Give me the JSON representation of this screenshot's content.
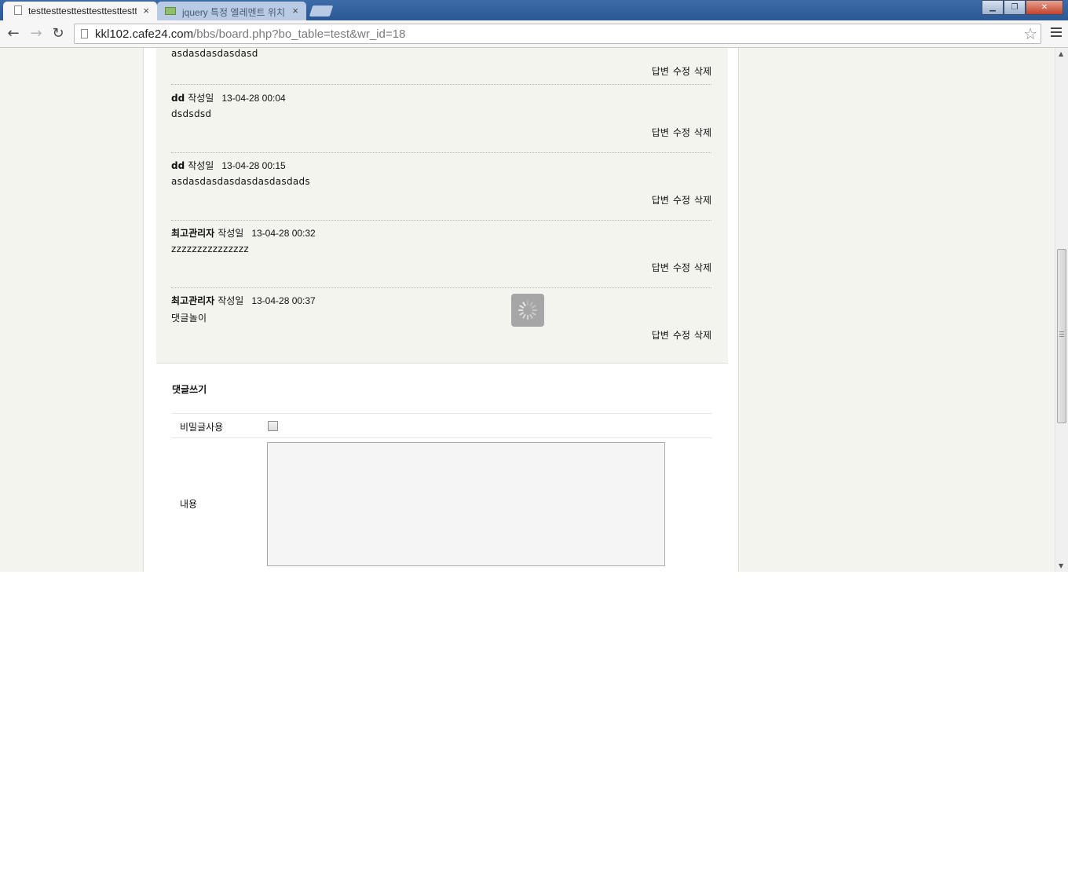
{
  "browser": {
    "tabs": [
      {
        "title": "testtesttesttesttesttesttesttest",
        "active": true,
        "close": "×"
      },
      {
        "title": "jquery 특정 엘레멘트 위치",
        "active": false,
        "close": "×"
      }
    ],
    "window_buttons": {
      "minimize": "▁",
      "maximize": "❐",
      "close": "✕"
    },
    "nav": {
      "back": "←",
      "forward": "→",
      "reload": "↻"
    },
    "url_host": "kkl102.cafe24.com",
    "url_path": "/bbs/board.php?bo_table=test&wr_id=18",
    "star": "☆"
  },
  "comments": [
    {
      "author": "",
      "label": "",
      "date": "",
      "body": "asdasdasdasdasd",
      "actions": [
        "답변",
        "수정",
        "삭제"
      ]
    },
    {
      "author": "dd",
      "label": "작성일",
      "date": "13-04-28 00:04",
      "body": "dsdsdsd",
      "actions": [
        "답변",
        "수정",
        "삭제"
      ]
    },
    {
      "author": "dd",
      "label": "작성일",
      "date": "13-04-28 00:15",
      "body": "asdasdasdasdasdasdasdads",
      "actions": [
        "답변",
        "수정",
        "삭제"
      ]
    },
    {
      "author": "최고관리자",
      "label": "작성일",
      "date": "13-04-28 00:32",
      "body": "zzzzzzzzzzzzzzz",
      "actions": [
        "답변",
        "수정",
        "삭제"
      ]
    },
    {
      "author": "최고관리자",
      "label": "작성일",
      "date": "13-04-28 00:37",
      "body": "댓글놀이",
      "actions": [
        "답변",
        "수정",
        "삭제"
      ]
    }
  ],
  "comment_form": {
    "title": "댓글쓰기",
    "secret_label": "비밀글사용",
    "secret_checked": false,
    "content_label": "내용",
    "content_value": ""
  },
  "colors": {
    "page_bg": "#f4f4ee",
    "content_bg": "#ffffff",
    "titlebar": "#2a5896"
  },
  "icons": [
    "page-icon",
    "star-icon",
    "menu-icon",
    "loading-spinner-icon"
  ]
}
